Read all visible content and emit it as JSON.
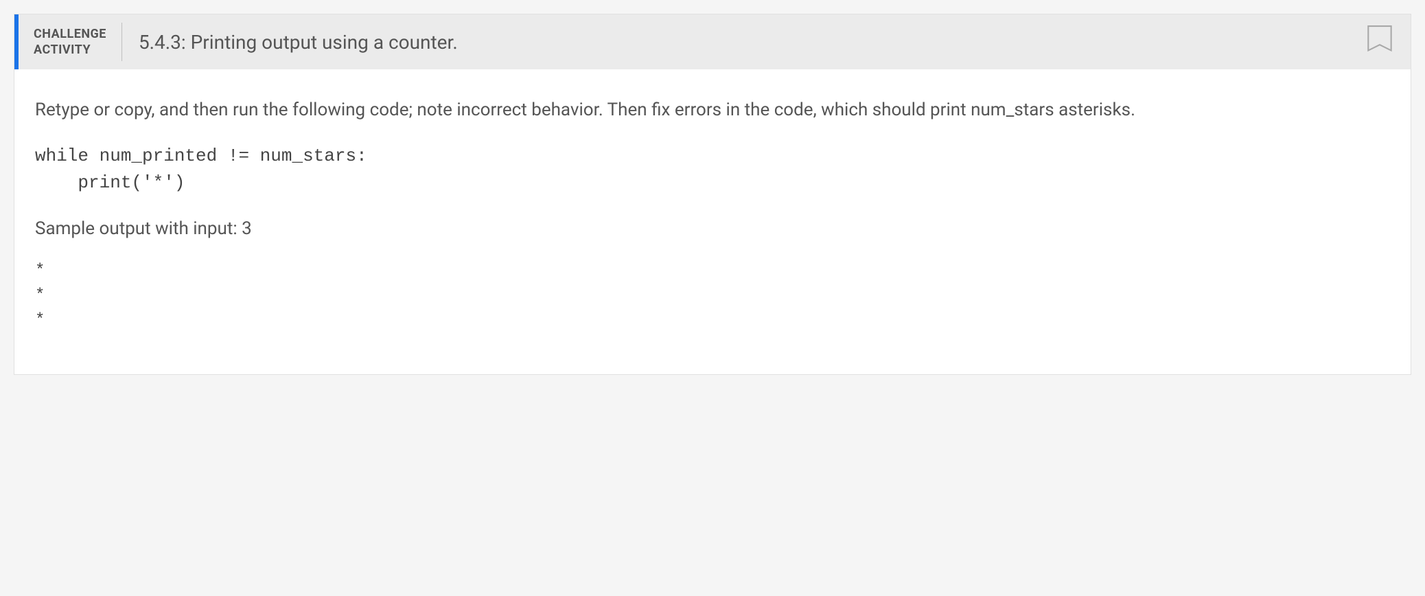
{
  "header": {
    "label_line1": "CHALLENGE",
    "label_line2": "ACTIVITY",
    "title": "5.4.3: Printing output using a counter."
  },
  "content": {
    "instructions": "Retype or copy, and then run the following code; note incorrect behavior. Then fix errors in the code, which should print num_stars asterisks.",
    "code": "while num_printed != num_stars:\n    print('*')",
    "sample_label": "Sample output with input: 3",
    "sample_output": "*\n*\n*"
  }
}
